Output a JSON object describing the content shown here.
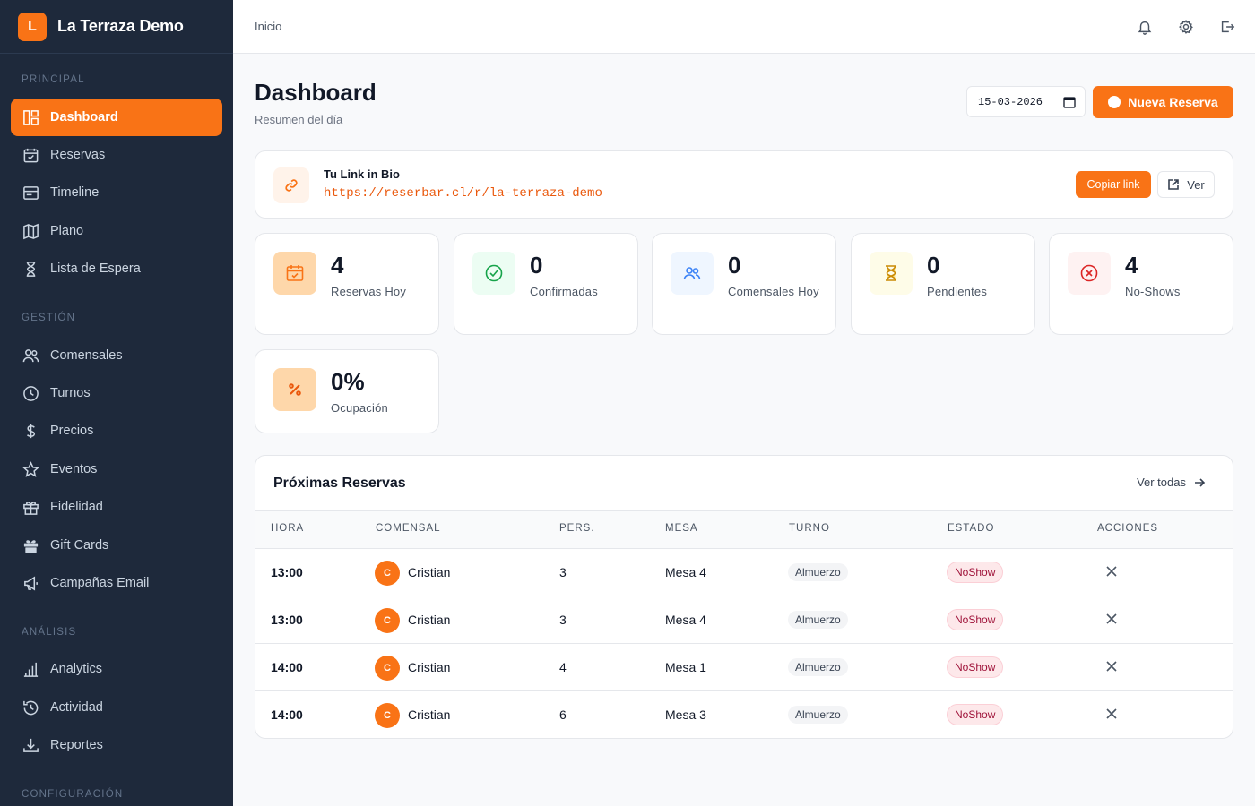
{
  "brand": {
    "logo_letter": "L",
    "name": "La Terraza Demo",
    "accent": "#f97316"
  },
  "sidebar": {
    "sections": [
      {
        "label": "PRINCIPAL",
        "items": [
          {
            "label": "Dashboard",
            "icon": "dashboard-icon",
            "active": true
          },
          {
            "label": "Reservas",
            "icon": "calendar-check-icon"
          },
          {
            "label": "Timeline",
            "icon": "timeline-icon"
          },
          {
            "label": "Plano",
            "icon": "map-icon"
          },
          {
            "label": "Lista de Espera",
            "icon": "hourglass-icon"
          }
        ]
      },
      {
        "label": "GESTIÓN",
        "items": [
          {
            "label": "Comensales",
            "icon": "users-icon"
          },
          {
            "label": "Turnos",
            "icon": "clock-icon"
          },
          {
            "label": "Precios",
            "icon": "dollar-icon"
          },
          {
            "label": "Eventos",
            "icon": "star-icon"
          },
          {
            "label": "Fidelidad",
            "icon": "gift-icon"
          },
          {
            "label": "Gift Cards",
            "icon": "gift-card-icon"
          },
          {
            "label": "Campañas Email",
            "icon": "megaphone-icon"
          }
        ]
      },
      {
        "label": "ANÁLISIS",
        "items": [
          {
            "label": "Analytics",
            "icon": "bar-chart-icon"
          },
          {
            "label": "Actividad",
            "icon": "activity-clock-icon"
          },
          {
            "label": "Reportes",
            "icon": "download-icon"
          }
        ]
      },
      {
        "label": "CONFIGURACIÓN",
        "items": []
      }
    ]
  },
  "topbar": {
    "breadcrumb": "Inicio"
  },
  "header": {
    "title": "Dashboard",
    "subtitle": "Resumen del día",
    "date_value": "15-03-2026",
    "new_button": "Nueva Reserva"
  },
  "bio": {
    "title": "Tu Link in Bio",
    "url": "https://reserbar.cl/r/la-terraza-demo",
    "copy_label": "Copiar link",
    "view_label": "Ver"
  },
  "stats": [
    {
      "value": "4",
      "label": "Reservas Hoy",
      "icon": "calendar-icon",
      "bg": "#fed7aa",
      "fg": "#f97316"
    },
    {
      "value": "0",
      "label": "Confirmadas",
      "icon": "check-circle-icon",
      "bg": "#ecfdf3",
      "fg": "#16a34a"
    },
    {
      "value": "0",
      "label": "Comensales Hoy",
      "icon": "users-icon",
      "bg": "#eff6ff",
      "fg": "#3b82f6"
    },
    {
      "value": "0",
      "label": "Pendientes",
      "icon": "hourglass-icon",
      "bg": "#fefce8",
      "fg": "#ca8a04"
    },
    {
      "value": "4",
      "label": "No-Shows",
      "icon": "x-circle-icon",
      "bg": "#fef2f2",
      "fg": "#dc2626"
    },
    {
      "value": "0%",
      "label": "Ocupación",
      "icon": "percent-icon",
      "bg": "#fed7aa",
      "fg": "#ea580c"
    }
  ],
  "upcoming": {
    "title": "Próximas Reservas",
    "see_all": "Ver todas",
    "columns": [
      "HORA",
      "COMENSAL",
      "PERS.",
      "MESA",
      "TURNO",
      "ESTADO",
      "ACCIONES"
    ],
    "rows": [
      {
        "time": "13:00",
        "initial": "C",
        "name": "Cristian",
        "people": "3",
        "table": "Mesa 4",
        "shift": "Almuerzo",
        "status": "NoShow"
      },
      {
        "time": "13:00",
        "initial": "C",
        "name": "Cristian",
        "people": "3",
        "table": "Mesa 4",
        "shift": "Almuerzo",
        "status": "NoShow"
      },
      {
        "time": "14:00",
        "initial": "C",
        "name": "Cristian",
        "people": "4",
        "table": "Mesa 1",
        "shift": "Almuerzo",
        "status": "NoShow"
      },
      {
        "time": "14:00",
        "initial": "C",
        "name": "Cristian",
        "people": "6",
        "table": "Mesa 3",
        "shift": "Almuerzo",
        "status": "NoShow"
      }
    ]
  }
}
